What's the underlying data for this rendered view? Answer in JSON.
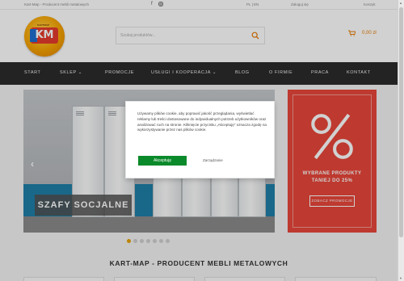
{
  "topbar": {
    "tagline": "Kart-Map - Producent mebli metalowych",
    "social": [
      "facebook-icon",
      "instagram-icon"
    ],
    "language": "PL | EN",
    "login": "Zaloguj się",
    "cart_small": "Koszyk"
  },
  "header": {
    "logo_text": "KARTMAP",
    "logo_letters": "KM",
    "search_placeholder": "Szukaj produktów...",
    "cart_total": "0,00 zł"
  },
  "nav": {
    "items": [
      {
        "label": "Start"
      },
      {
        "label": "Sklep",
        "dropdown": true
      },
      {
        "label": "Promocje"
      },
      {
        "label": "Usługi i kooperacja",
        "dropdown": true
      },
      {
        "label": "Blog"
      },
      {
        "label": "O firmie"
      },
      {
        "label": "Praca"
      },
      {
        "label": "Kontakt"
      }
    ]
  },
  "slider": {
    "caption": "SZAFY SOCJALNE",
    "prev_icon": "chevron-left-icon",
    "slide_count": 7,
    "active_index": 0
  },
  "promo": {
    "symbol": "%",
    "line1": "WYBRANE PRODUKTY",
    "line2": "TANIEJ DO 25%",
    "button": "ZOBACZ PROMOCJE"
  },
  "section": {
    "heading": "KART-MAP - PRODUCENT MEBLI METALOWYCH"
  },
  "cookie": {
    "message": "Używamy plików cookie, aby poprawić jakość przeglądania, wyświetlać reklamy lub treści dostosowane do indywidualnych potrzeb użytkowników oraz analizować ruch na stronie. Kliknięcie przycisku „Akceptuję\" oznacza zgodę na wykorzystywanie przez nas plików cookie.",
    "accept": "Akceptuję",
    "manage": "Zarządzanie"
  },
  "colors": {
    "nav_bg": "#2b2b2b",
    "accent": "#e77a00",
    "promo_bg": "#e8463a",
    "accept_btn": "#0b8a2b",
    "active_dot": "#e6a200"
  }
}
